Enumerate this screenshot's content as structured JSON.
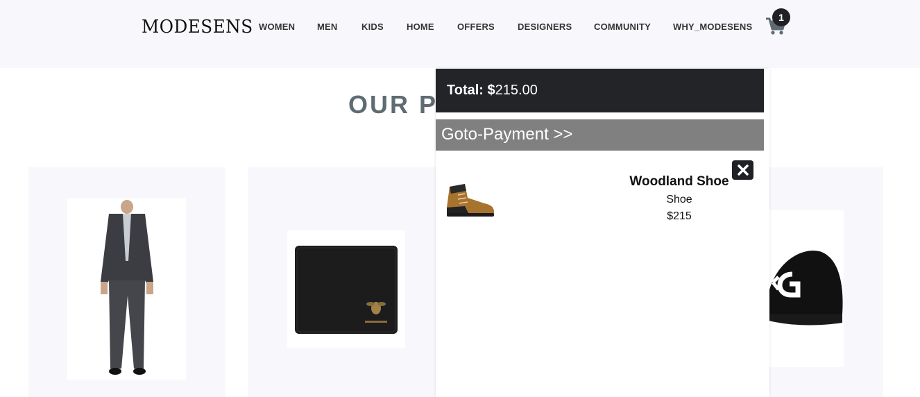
{
  "header": {
    "logo": "MODESENS",
    "nav": [
      {
        "label": "WOMEN"
      },
      {
        "label": "MEN"
      },
      {
        "label": "KIDS"
      },
      {
        "label": "HOME"
      },
      {
        "label": "OFFERS"
      },
      {
        "label": "DESIGNERS"
      },
      {
        "label": "COMMUNITY"
      },
      {
        "label": "WHY_MODESENS"
      }
    ],
    "cart_count": "1",
    "cart_icon": "shopping-cart-icon"
  },
  "main": {
    "heading": "OUR PI"
  },
  "cart_panel": {
    "total_label": "Total:",
    "total_currency": "$",
    "total_value": "215.00",
    "payment_label": "Goto-Payment >>",
    "items": [
      {
        "name": "Woodland Shoe",
        "category": "Shoe",
        "price": "$215"
      }
    ],
    "close_icon": "close-icon"
  },
  "colors": {
    "navbar_bg": "#f8f8fc",
    "dark": "#222428",
    "payment_bar": "#808080",
    "heading": "#5f6b72"
  }
}
